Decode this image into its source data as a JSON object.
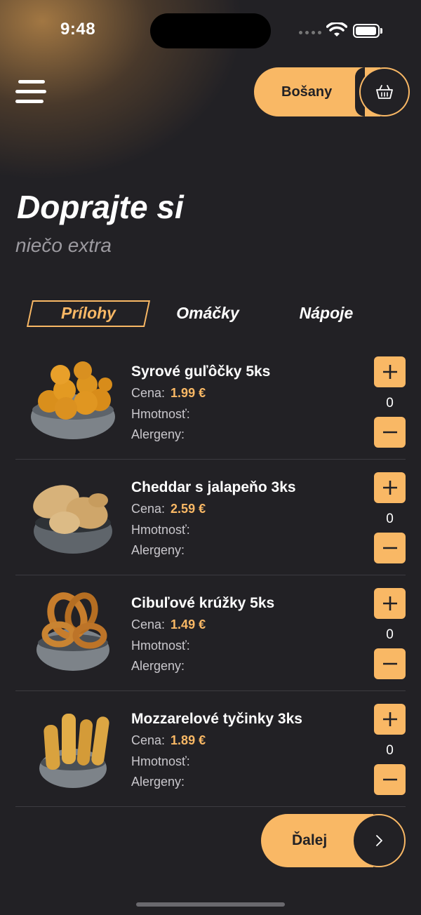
{
  "status_bar": {
    "time": "9:48"
  },
  "header": {
    "location_label": "Bošany",
    "menu_icon": "hamburger-menu-icon",
    "cart_icon": "shopping-basket-icon"
  },
  "hero": {
    "title": "Doprajte si",
    "subtitle": "niečo extra"
  },
  "tabs": [
    {
      "label": "Prílohy",
      "active": true
    },
    {
      "label": "Omáčky",
      "active": false
    },
    {
      "label": "Nápoje",
      "active": false
    }
  ],
  "products": [
    {
      "name": "Syrové guľôčky 5ks",
      "price_label": "Cena:",
      "price": "1.99 €",
      "weight_label": "Hmotnosť:",
      "allergen_label": "Alergeny:",
      "quantity": "0",
      "image": "cheese-balls-bowl"
    },
    {
      "name": "Cheddar s jalapeňo 3ks",
      "price_label": "Cena:",
      "price": "2.59 €",
      "weight_label": "Hmotnosť:",
      "allergen_label": "Alergeny:",
      "quantity": "0",
      "image": "jalapeno-poppers-bowl"
    },
    {
      "name": "Cibuľové krúžky 5ks",
      "price_label": "Cena:",
      "price": "1.49 €",
      "weight_label": "Hmotnosť:",
      "allergen_label": "Alergeny:",
      "quantity": "0",
      "image": "onion-rings-bowl"
    },
    {
      "name": "Mozzarelové tyčinky 3ks",
      "price_label": "Cena:",
      "price": "1.89 €",
      "weight_label": "Hmotnosť:",
      "allergen_label": "Alergeny:",
      "quantity": "0",
      "image": "mozzarella-sticks-bowl"
    }
  ],
  "footer": {
    "next_label": "Ďalej",
    "next_icon": "chevron-right-icon"
  },
  "colors": {
    "accent": "#f9b865",
    "background": "#222125",
    "muted_text": "#c9c7cc"
  }
}
